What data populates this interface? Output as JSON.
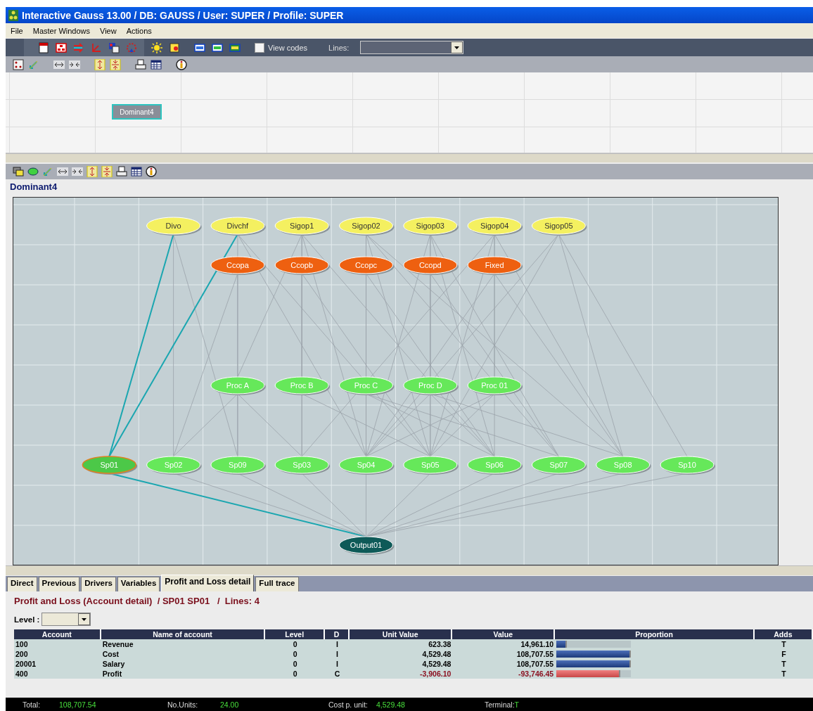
{
  "window": {
    "title": "Interactive Gauss 13.00 / DB: GAUSS / User: SUPER / Profile: SUPER"
  },
  "menu": [
    "File",
    "Master Windows",
    "View",
    "Actions"
  ],
  "toolbar": {
    "view_codes": {
      "label": "View codes",
      "checked": false
    },
    "lines": {
      "label": "Lines:"
    }
  },
  "top_panel": {
    "node": {
      "label": "Dominant4",
      "selected": true
    }
  },
  "diagram": {
    "title": "Dominant4",
    "layers": [
      [
        {
          "label": "Divo",
          "kind": "source",
          "selected": false
        },
        {
          "label": "Divchf",
          "kind": "source",
          "selected": false
        },
        {
          "label": "Sigop1",
          "kind": "source",
          "selected": false
        },
        {
          "label": "Sigop02",
          "kind": "source",
          "selected": false
        },
        {
          "label": "Sigop03",
          "kind": "source",
          "selected": false
        },
        {
          "label": "Sigop04",
          "kind": "source",
          "selected": false
        },
        {
          "label": "Sigop05",
          "kind": "source",
          "selected": false
        }
      ],
      [
        {
          "label": "Ccopa",
          "kind": "cost",
          "selected": false
        },
        {
          "label": "Ccopb",
          "kind": "cost",
          "selected": false
        },
        {
          "label": "Ccopc",
          "kind": "cost",
          "selected": false
        },
        {
          "label": "Ccopd",
          "kind": "cost",
          "selected": false
        },
        {
          "label": "Fixed",
          "kind": "cost",
          "selected": false
        }
      ],
      [
        {
          "label": "Proc A",
          "kind": "process",
          "selected": false
        },
        {
          "label": "Proc B",
          "kind": "process",
          "selected": false
        },
        {
          "label": "Proc C",
          "kind": "process",
          "selected": false
        },
        {
          "label": "Proc D",
          "kind": "process",
          "selected": false
        },
        {
          "label": "Proc 01",
          "kind": "process",
          "selected": false
        }
      ],
      [
        {
          "label": "Sp01",
          "kind": "process",
          "selected": true
        },
        {
          "label": "Sp02",
          "kind": "process",
          "selected": false
        },
        {
          "label": "Sp09",
          "kind": "process",
          "selected": false
        },
        {
          "label": "Sp03",
          "kind": "process",
          "selected": false
        },
        {
          "label": "Sp04",
          "kind": "process",
          "selected": false
        },
        {
          "label": "Sp05",
          "kind": "process",
          "selected": false
        },
        {
          "label": "Sp06",
          "kind": "process",
          "selected": false
        },
        {
          "label": "Sp07",
          "kind": "process",
          "selected": false
        },
        {
          "label": "Sp08",
          "kind": "process",
          "selected": false
        },
        {
          "label": "Sp10",
          "kind": "process",
          "selected": false
        }
      ],
      [
        {
          "label": "Output01",
          "kind": "output",
          "selected": false
        }
      ]
    ]
  },
  "tabs": [
    {
      "label": "Direct",
      "selected": false
    },
    {
      "label": "Previous",
      "selected": false
    },
    {
      "label": "Drivers",
      "selected": false
    },
    {
      "label": "Variables",
      "selected": false
    },
    {
      "label": "Profit and Loss detail",
      "selected": true
    },
    {
      "label": "Full trace",
      "selected": false
    }
  ],
  "detail": {
    "heading": "Profit and Loss (Account detail)  / SP01 SP01   /  Lines: 4",
    "level_label": "Level :",
    "columns": [
      "Account",
      "Name of account",
      "Level",
      "D",
      "Unit Value",
      "Value",
      "Proportion",
      "Adds"
    ],
    "rows": [
      {
        "account": "100",
        "name": "Revenue",
        "level_text": "0",
        "d": "I",
        "unit_value": "623.38",
        "value": "14,961.10",
        "level": 0.14,
        "negative": false,
        "adds": "T"
      },
      {
        "account": "200",
        "name": "Cost",
        "level_text": "0",
        "d": "I",
        "unit_value": "4,529.48",
        "value": "108,707.55",
        "level": 1.0,
        "negative": false,
        "adds": "F"
      },
      {
        "account": "20001",
        "name": "Salary",
        "level_text": "0",
        "d": "I",
        "unit_value": "4,529.48",
        "value": "108,707.55",
        "level": 1.0,
        "negative": false,
        "adds": "T"
      },
      {
        "account": "400",
        "name": "Profit",
        "level_text": "0",
        "d": "C",
        "unit_value": "-3,906.10",
        "value": "-93,746.45",
        "level": 0.86,
        "negative": true,
        "adds": "T"
      }
    ]
  },
  "status_bar": [
    {
      "label": "Total:",
      "value": "108,707.54"
    },
    {
      "label": "No.Units:",
      "value": "24.00"
    },
    {
      "label": "Cost p. unit:",
      "value": "4,529.48"
    },
    {
      "label": "Terminal:",
      "value": "T"
    }
  ]
}
